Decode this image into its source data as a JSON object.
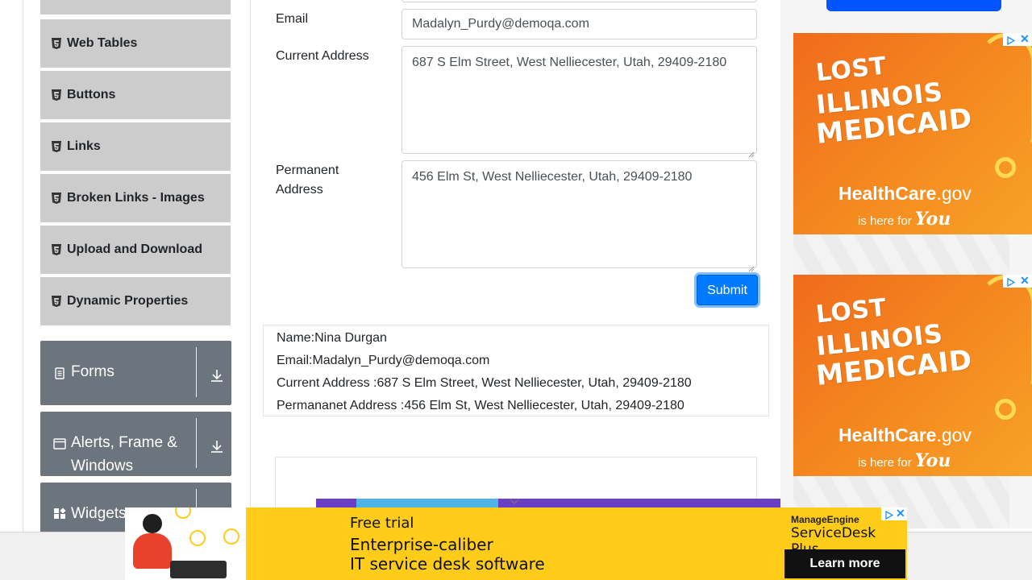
{
  "sidebar": {
    "elements_items": [
      {
        "label": "Web Tables"
      },
      {
        "label": "Buttons"
      },
      {
        "label": "Links"
      },
      {
        "label": "Broken Links - Images"
      },
      {
        "label": "Upload and Download"
      },
      {
        "label": "Dynamic Properties"
      }
    ],
    "groups": [
      {
        "label": "Forms",
        "icon": "form-icon"
      },
      {
        "label": "Alerts, Frame & Windows",
        "icon": "window-icon"
      },
      {
        "label": "Widgets",
        "icon": "widgets-icon"
      }
    ]
  },
  "form": {
    "email_label": "Email",
    "email_value": "Madalyn_Purdy@demoqa.com",
    "current_address_label": "Current Address",
    "current_address_value": "687 S Elm Street, West Nelliecester, Utah, 29409-2180",
    "permanent_address_label": "Permanent Address",
    "permanent_address_value": "456 Elm St, West Nelliecester, Utah, 29409-2180",
    "submit_label": "Submit"
  },
  "output": {
    "name": "Name:Nina Durgan",
    "email": "Email:Madalyn_Purdy@demoqa.com",
    "current_address": "Current Address :687 S Elm Street, West Nelliecester, Utah, 29409-2180",
    "permanent_address": "Permananet Address :456 Elm St, West Nelliecester, Utah, 29409-2180"
  },
  "ads": {
    "medicaid": {
      "line1": "LOST",
      "line2": "ILLINOIS",
      "line3": "MEDICAID",
      "brand_main": "HealthCare",
      "brand_suffix": ".gov",
      "tag_prefix": "is here for",
      "tag_you": "You"
    },
    "servicedesk": {
      "line1": "Free trial",
      "line2": "Enterprise-caliber",
      "line3": "IT service desk software",
      "brand_small": "ManageEngine",
      "brand_product": "ServiceDesk Plus",
      "cta": "Learn more"
    },
    "ad_close": "✕"
  },
  "colors": {
    "primary": "#007bff",
    "sidebar_item_bg": "#cccccc",
    "group_bg": "#6c757d",
    "medicaid_orange": "#f58a1f",
    "servicedesk_yellow": "#ffcc1a"
  }
}
